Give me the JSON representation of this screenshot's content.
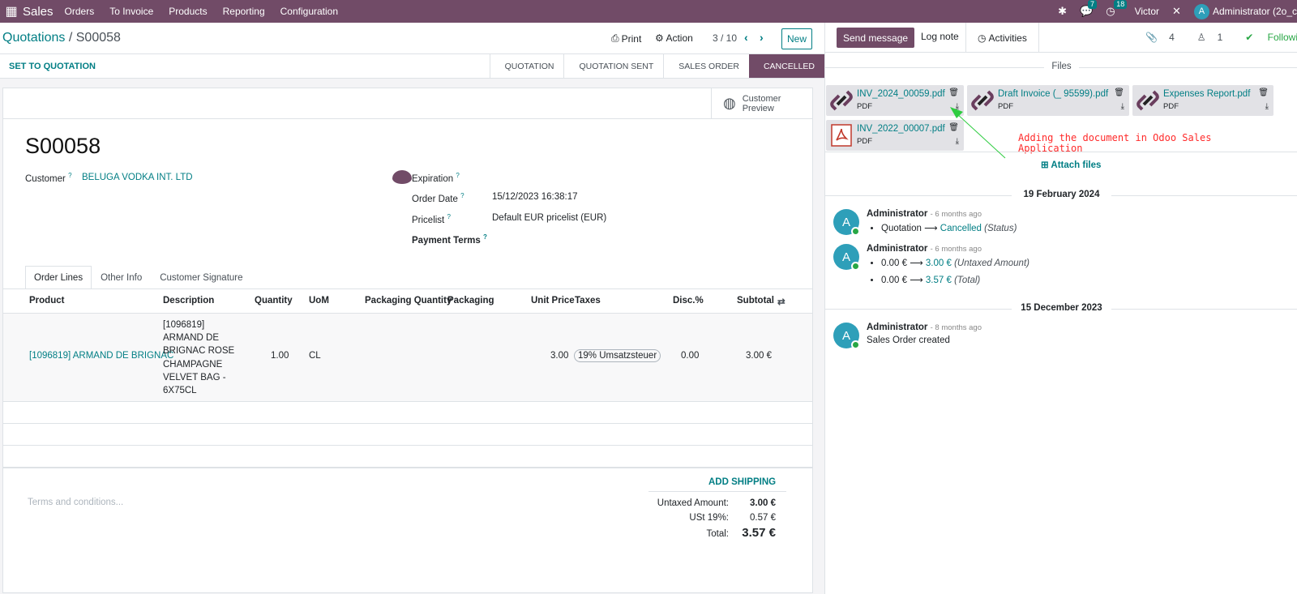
{
  "topbar": {
    "app_name": "Sales",
    "menus": [
      "Orders",
      "To Invoice",
      "Products",
      "Reporting",
      "Configuration"
    ],
    "messages_count": "7",
    "activities_count": "18",
    "company": "Victor",
    "user": "Administrator (2o_c",
    "user_initial": "A"
  },
  "control_panel": {
    "breadcrumb_parent": "Quotations",
    "breadcrumb_sep": "/",
    "breadcrumb_current": "S00058",
    "print_label": "Print",
    "action_label": "Action",
    "pager": "3 / 10",
    "new_label": "New"
  },
  "statusbar": {
    "set_to_quotation": "SET TO QUOTATION",
    "stages": [
      "QUOTATION",
      "QUOTATION SENT",
      "SALES ORDER",
      "CANCELLED"
    ],
    "active_stage": "CANCELLED"
  },
  "form": {
    "customer_preview_1": "Customer",
    "customer_preview_2": "Preview",
    "name": "S00058",
    "customer_label": "Customer",
    "customer_value": "BELUGA VODKA INT. LTD",
    "expiration_label": "Expiration",
    "order_date_label": "Order Date",
    "order_date_value": "15/12/2023 16:38:17",
    "pricelist_label": "Pricelist",
    "pricelist_value": "Default EUR pricelist (EUR)",
    "payment_terms_label": "Payment Terms",
    "help_mark": "?",
    "tabs": [
      "Order Lines",
      "Other Info",
      "Customer Signature"
    ],
    "columns": [
      "Product",
      "Description",
      "Quantity",
      "UoM",
      "Packaging Quantity",
      "Packaging",
      "Unit Price",
      "Taxes",
      "Disc.%",
      "Subtotal"
    ],
    "line": {
      "product": "[1096819] ARMAND DE BRIGNAC",
      "description": [
        "[1096819]",
        "ARMAND DE",
        "BRIGNAC ROSE",
        "CHAMPAGNE",
        "VELVET BAG -",
        "6X75CL"
      ],
      "quantity": "1.00",
      "uom": "CL",
      "unit_price": "3.00",
      "tax": "19% Umsatzsteuer",
      "discount": "0.00",
      "subtotal": "3.00 €"
    },
    "terms_placeholder": "Terms and conditions...",
    "add_shipping": "ADD SHIPPING",
    "untaxed_label": "Untaxed Amount:",
    "untaxed_value": "3.00 €",
    "tax_label": "USt 19%:",
    "tax_value": "0.57 €",
    "total_label": "Total:",
    "total_value": "3.57 €"
  },
  "chatter": {
    "send_message": "Send message",
    "log_note": "Log note",
    "activities": "Activities",
    "attachments_count": "4",
    "followers_count": "1",
    "following": "Followi",
    "files_header": "Files",
    "files": [
      {
        "name": "INV_2024_00059.pdf",
        "type": "PDF",
        "icon": "link-icon"
      },
      {
        "name": "Draft Invoice (_ 95599).pdf",
        "type": "PDF",
        "icon": "link-icon"
      },
      {
        "name": "Expenses Report.pdf",
        "type": "PDF",
        "icon": "link-icon"
      },
      {
        "name": "INV_2022_00007.pdf",
        "type": "PDF",
        "icon": "pdf-icon"
      }
    ],
    "annotation": "Adding the document in Odoo Sales Application",
    "attach_files": "Attach files",
    "date1": "19 February 2024",
    "date2": "15 December 2023",
    "messages": [
      {
        "author": "Administrator",
        "ago": "- 6 months ago",
        "old": "Quotation",
        "new": "Cancelled",
        "field": "(Status)"
      },
      {
        "author": "Administrator",
        "ago": "- 6 months ago",
        "old1": "0.00 €",
        "new1": "3.00 €",
        "field1": "(Untaxed Amount)",
        "old2": "0.00 €",
        "new2": "3.57 €",
        "field2": "(Total)"
      },
      {
        "author": "Administrator",
        "ago": "- 8 months ago",
        "body": "Sales Order created"
      }
    ]
  },
  "colors": {
    "brand": "#714b67",
    "accent": "#017e84",
    "annotation": "#ff2a2a"
  }
}
